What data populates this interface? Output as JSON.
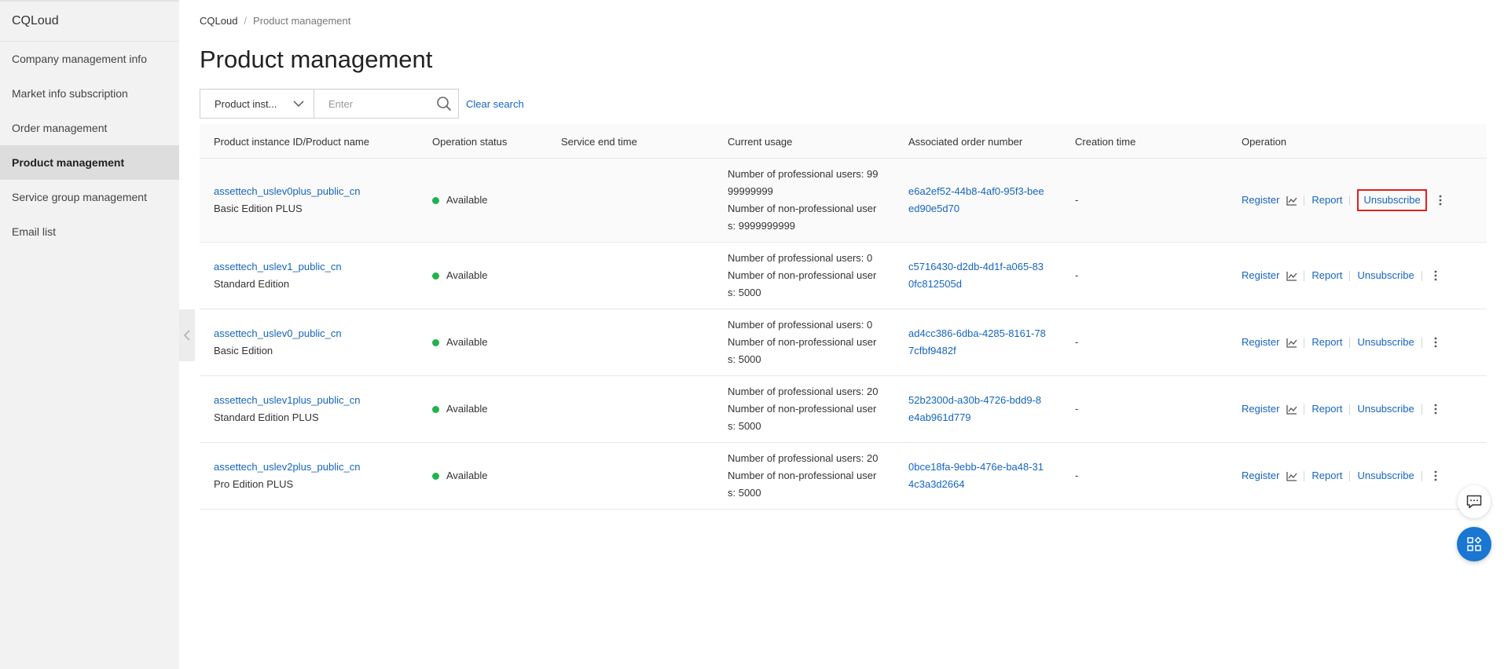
{
  "sidebar": {
    "brand": "CQLoud",
    "items": [
      {
        "label": "Company management info"
      },
      {
        "label": "Market info subscription"
      },
      {
        "label": "Order management"
      },
      {
        "label": "Product management"
      },
      {
        "label": "Service group management"
      },
      {
        "label": "Email list"
      }
    ],
    "active_index": 3
  },
  "breadcrumb": {
    "root": "CQLoud",
    "separator": "/",
    "current": "Product management"
  },
  "page_title": "Product management",
  "search": {
    "select_value": "Product inst...",
    "placeholder": "Enter",
    "clear_label": "Clear search"
  },
  "table": {
    "headers": {
      "product": "Product instance ID/Product name",
      "status": "Operation status",
      "end_time": "Service end time",
      "usage": "Current usage",
      "order": "Associated order number",
      "creation": "Creation time",
      "operation": "Operation"
    },
    "actions": {
      "register": "Register",
      "report": "Report",
      "unsubscribe": "Unsubscribe"
    },
    "rows": [
      {
        "id": "assettech_uslev0plus_public_cn",
        "name": "Basic Edition PLUS",
        "status": "Available",
        "end_time": "",
        "usage_lines": [
          "Number of professional users: 99",
          "99999999",
          "Number of non-professional user",
          "s: 9999999999"
        ],
        "order_lines": [
          "e6a2ef52-44b8-4af0-95f3-bee",
          "ed90e5d70"
        ],
        "creation": "-"
      },
      {
        "id": "assettech_uslev1_public_cn",
        "name": "Standard Edition",
        "status": "Available",
        "end_time": "",
        "usage_lines": [
          "Number of professional users: 0",
          "Number of non-professional user",
          "s: 5000"
        ],
        "order_lines": [
          "c5716430-d2db-4d1f-a065-83",
          "0fc812505d"
        ],
        "creation": "-"
      },
      {
        "id": "assettech_uslev0_public_cn",
        "name": "Basic Edition",
        "status": "Available",
        "end_time": "",
        "usage_lines": [
          "Number of professional users: 0",
          "Number of non-professional user",
          "s: 5000"
        ],
        "order_lines": [
          "ad4cc386-6dba-4285-8161-78",
          "7cfbf9482f"
        ],
        "creation": "-"
      },
      {
        "id": "assettech_uslev1plus_public_cn",
        "name": "Standard Edition PLUS",
        "status": "Available",
        "end_time": "",
        "usage_lines": [
          "Number of professional users: 20",
          "Number of non-professional user",
          "s: 5000"
        ],
        "order_lines": [
          "52b2300d-a30b-4726-bdd9-8",
          "e4ab961d779"
        ],
        "creation": "-"
      },
      {
        "id": "assettech_uslev2plus_public_cn",
        "name": "Pro Edition PLUS",
        "status": "Available",
        "end_time": "",
        "usage_lines": [
          "Number of professional users: 20",
          "Number of non-professional user",
          "s: 5000"
        ],
        "order_lines": [
          "0bce18fa-9ebb-476e-ba48-31",
          "4c3a3d2664"
        ],
        "creation": "-"
      }
    ]
  },
  "icons": {
    "collapse": "chevron-left-icon",
    "select_arrow": "chevron-down-icon",
    "search": "search-icon",
    "monitor": "line-chart-icon",
    "more": "more-vertical-icon",
    "chat": "chat-icon",
    "apps": "apps-icon"
  },
  "colors": {
    "link": "#1565c0",
    "status_available": "#22b14c",
    "highlight_border": "#e02020",
    "float_primary": "#1976d2"
  }
}
